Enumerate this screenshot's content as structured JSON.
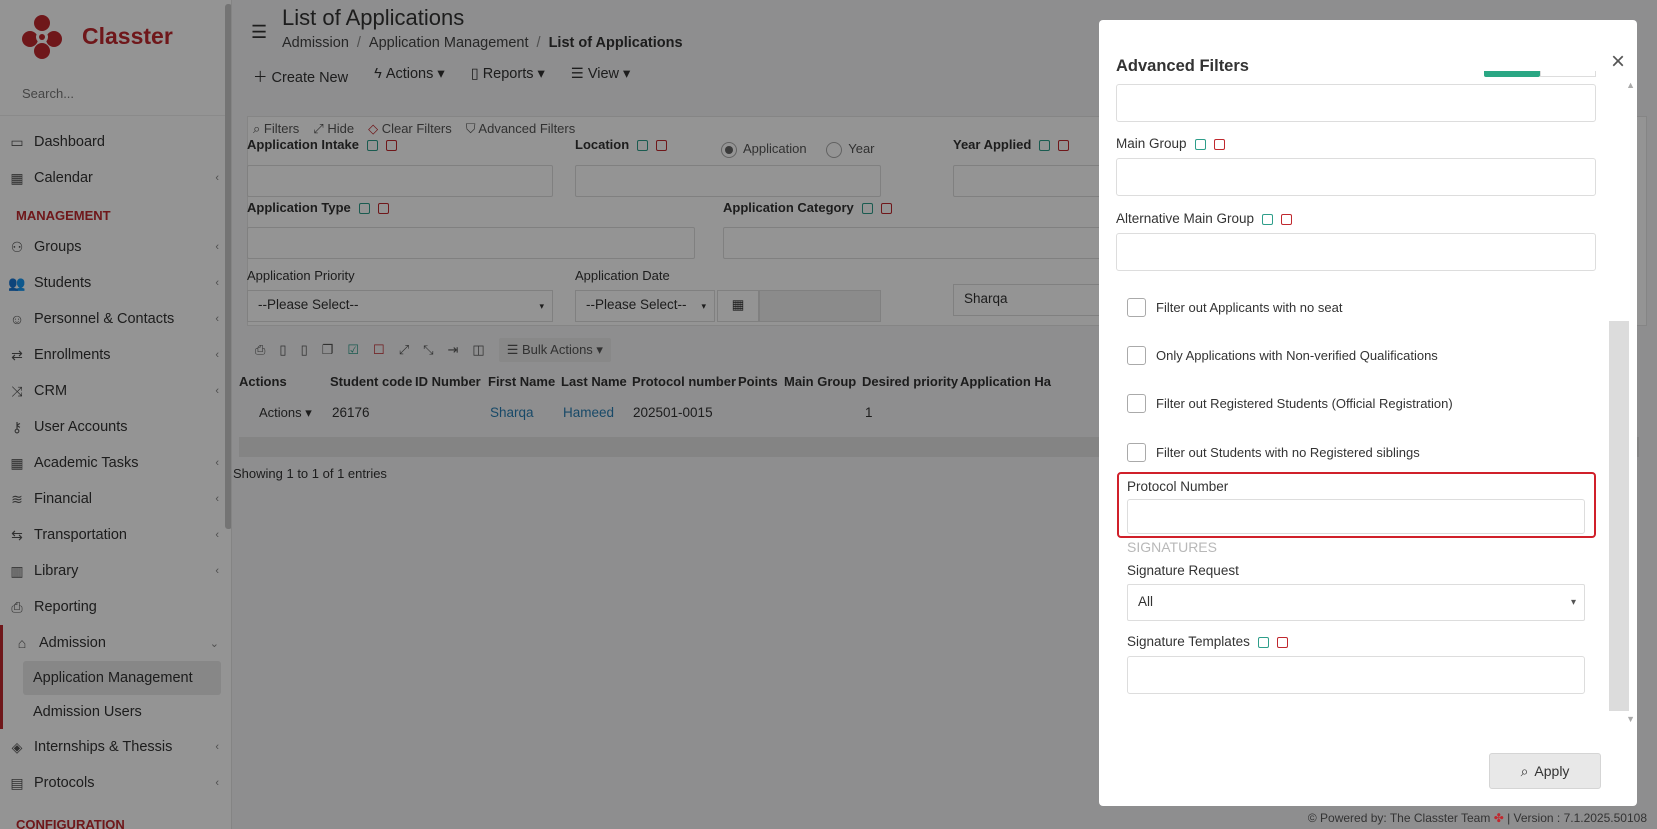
{
  "app": {
    "name": "Classter",
    "search_placeholder": "Search..."
  },
  "sidebar": {
    "items_top": [
      {
        "label": "Dashboard",
        "icon": "monitor-icon"
      },
      {
        "label": "Calendar",
        "icon": "calendar-icon"
      }
    ],
    "section_management": "MANAGEMENT",
    "items_mgmt": [
      {
        "label": "Groups",
        "icon": "groups-icon"
      },
      {
        "label": "Students",
        "icon": "students-icon"
      },
      {
        "label": "Personnel & Contacts",
        "icon": "contacts-icon"
      },
      {
        "label": "Enrollments",
        "icon": "enrollments-icon"
      },
      {
        "label": "CRM",
        "icon": "crm-icon"
      },
      {
        "label": "User Accounts",
        "icon": "key-icon"
      },
      {
        "label": "Academic Tasks",
        "icon": "tasks-icon"
      },
      {
        "label": "Financial",
        "icon": "coins-icon"
      },
      {
        "label": "Transportation",
        "icon": "bus-icon"
      },
      {
        "label": "Library",
        "icon": "library-icon"
      },
      {
        "label": "Reporting",
        "icon": "printer-icon"
      }
    ],
    "admission": "Admission",
    "admission_sub": [
      "Application Management",
      "Admission Users"
    ],
    "items_bottom": [
      {
        "label": "Internships & Thessis",
        "icon": "internship-icon"
      },
      {
        "label": "Protocols",
        "icon": "protocols-icon"
      }
    ],
    "section_config": "CONFIGURATION"
  },
  "header": {
    "title": "List of Applications",
    "breadcrumb": [
      "Admission",
      "Application Management",
      "List of Applications"
    ]
  },
  "toolbar": {
    "create": "Create New",
    "actions": "Actions",
    "reports": "Reports",
    "view": "View"
  },
  "filters": {
    "filters": "Filters",
    "hide": "Hide",
    "clear": "Clear Filters",
    "advanced": "Advanced Filters",
    "application_intake": "Application Intake",
    "location": "Location",
    "radio_application": "Application",
    "radio_year": "Year",
    "year_applied": "Year Applied",
    "application_type": "Application Type",
    "application_category": "Application Category",
    "application_priority": "Application Priority",
    "application_date": "Application Date",
    "please_select": "--Please Select--",
    "sharqa": "Sharqa"
  },
  "table": {
    "bulk": "Bulk Actions",
    "headers": [
      "Actions",
      "Student code",
      "ID Number",
      "First Name",
      "Last Name",
      "Protocol number",
      "Points",
      "Main Group",
      "Desired priority",
      "Application Ha"
    ],
    "row": {
      "actions": "Actions",
      "student_code": "26176",
      "id_number": "",
      "first_name": "Sharqa",
      "last_name": "Hameed",
      "protocol": "202501-0015",
      "points": "",
      "main_group": "",
      "priority": "1"
    },
    "entries": "Showing 1 to 1 of 1 entries"
  },
  "modal": {
    "title": "Advanced Filters",
    "main_group": "Main Group",
    "alternative_main_group": "Alternative Main Group",
    "checkboxes": [
      "Filter out Applicants with no seat",
      "Only Applications with Non-verified Qualifications",
      "Filter out Registered Students (Official Registration)",
      "Filter out Students with no Registered siblings"
    ],
    "protocol_number": "Protocol Number",
    "protocol_value": "",
    "signatures_heading": "SIGNATURES",
    "signature_request": "Signature Request",
    "signature_request_value": "All",
    "signature_templates": "Signature Templates",
    "apply": "Apply"
  },
  "footer": {
    "powered": "Powered by: The Classter Team",
    "version": "| Version : 7.1.2025.50108"
  },
  "colors": {
    "brand": "#c0282e",
    "accent_green": "#2aa784",
    "link": "#2a7fb3",
    "highlight": "#d0202a"
  }
}
